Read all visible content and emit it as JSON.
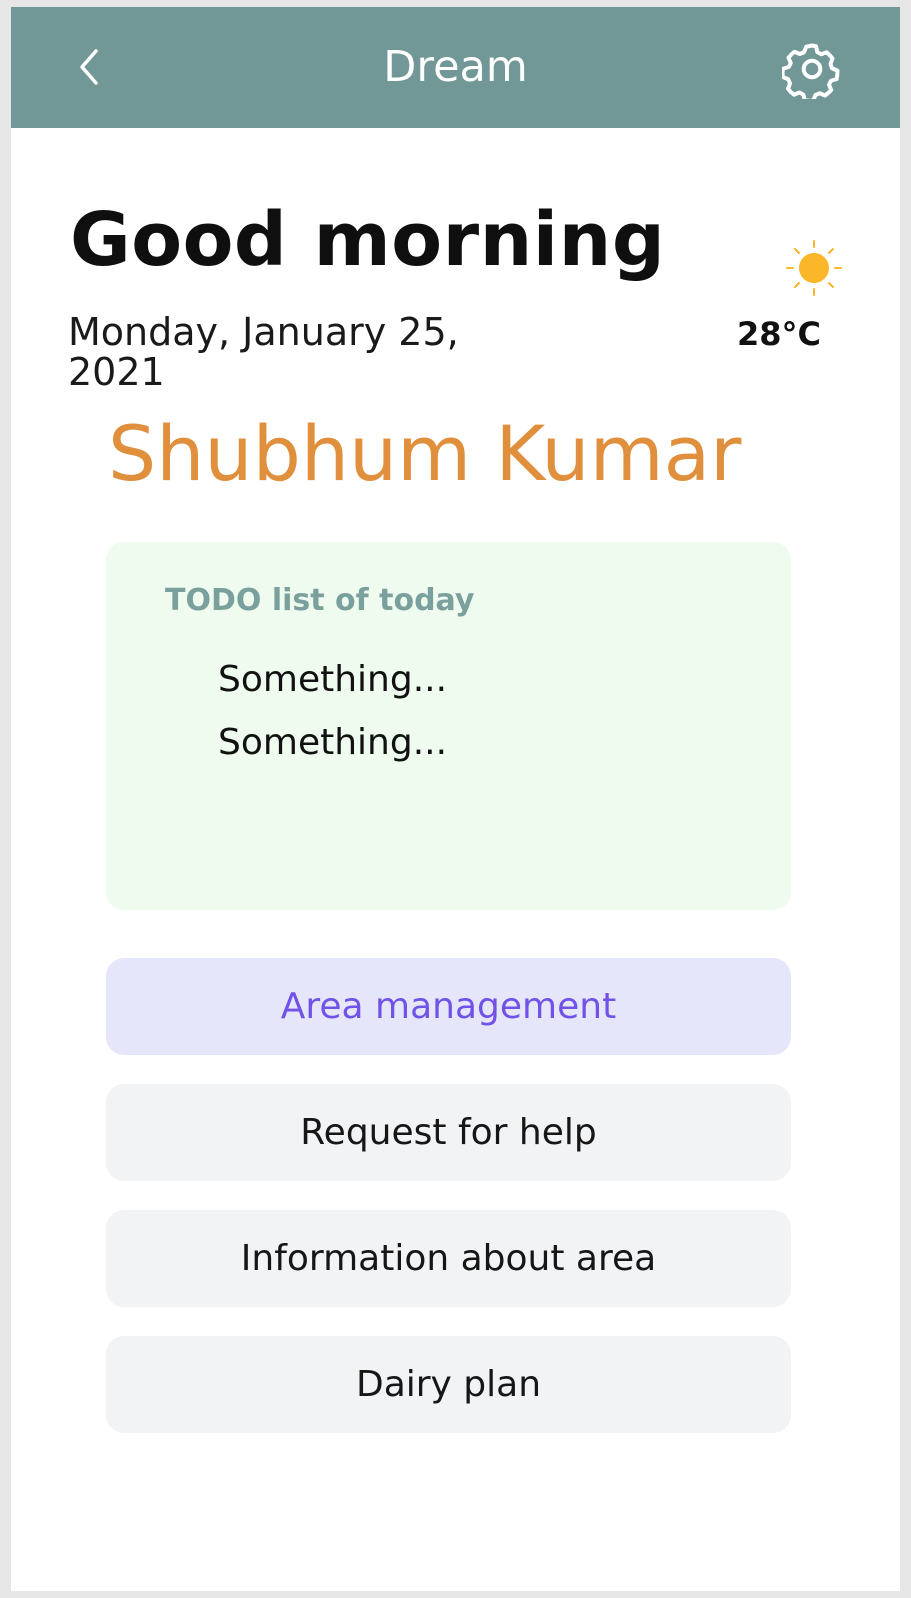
{
  "header": {
    "title": "Dream",
    "back_icon": "chevron-left-icon",
    "settings_icon": "gear-icon",
    "background_color": "#719796"
  },
  "greeting": {
    "title": "Good morning",
    "date": "Monday, January 25, 2021",
    "weather_icon": "sun-icon",
    "temperature": "28°C"
  },
  "user": {
    "name": "Shubhum Kumar",
    "name_color": "#e08f3c"
  },
  "todo": {
    "heading": "TODO list of today",
    "items": [
      "Something...",
      "Something..."
    ],
    "background_color": "#effbef"
  },
  "menu": {
    "items": [
      {
        "label": "Area management",
        "active": true
      },
      {
        "label": "Request for help",
        "active": false
      },
      {
        "label": "Information about area",
        "active": false
      },
      {
        "label": "Dairy plan",
        "active": false
      }
    ],
    "active_color": "#7152e8"
  }
}
